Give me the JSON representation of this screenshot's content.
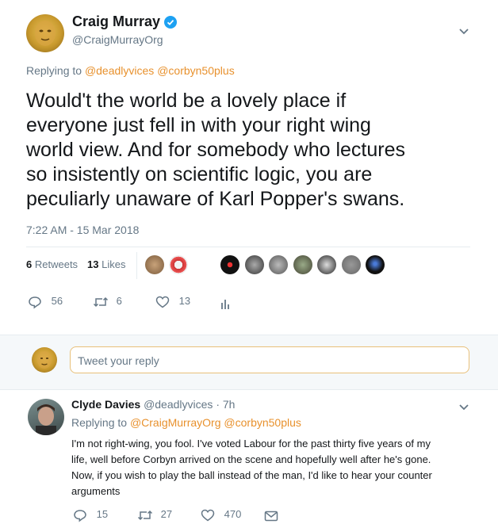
{
  "tweet": {
    "author_name": "Craig Murray",
    "author_handle": "@CraigMurrayOrg",
    "reply_prefix": "Replying to",
    "reply_to": [
      "@deadlyvices",
      "@corbyn50plus"
    ],
    "text_lines": [
      "Would't the world be a lovely place if",
      "everyone just fell in with your right wing",
      "world view. And for somebody who lectures",
      "so insistently on scientific logic, you are",
      "peculiarly unaware of Karl Popper's swans."
    ],
    "timestamp": "7:22 AM - 15 Mar 2018",
    "retweets_count": "6",
    "retweets_label": "Retweets",
    "likes_count": "13",
    "likes_label": "Likes",
    "actions": {
      "replies": "56",
      "retweets": "6",
      "likes": "13"
    }
  },
  "reply_box": {
    "placeholder": "Tweet your reply"
  },
  "reply": {
    "author_name": "Clyde Davies",
    "author_handle": "@deadlyvices",
    "age": "7h",
    "reply_prefix": "Replying to",
    "reply_to": [
      "@CraigMurrayOrg",
      "@corbyn50plus"
    ],
    "text_lines": [
      "I'm not right-wing, you fool.  I've voted Labour for the past thirty five years of my",
      "life, well before Corbyn arrived on the scene and hopefully well after he's gone.",
      "Now, if you wish to play the ball instead of the man, I'd like to hear your counter",
      "arguments"
    ],
    "actions": {
      "replies": "15",
      "retweets": "27",
      "likes": "470"
    }
  },
  "colors": {
    "verified": "#1da1f2",
    "link": "#e8912d",
    "muted": "#657786",
    "divider": "#e6ecf0"
  }
}
